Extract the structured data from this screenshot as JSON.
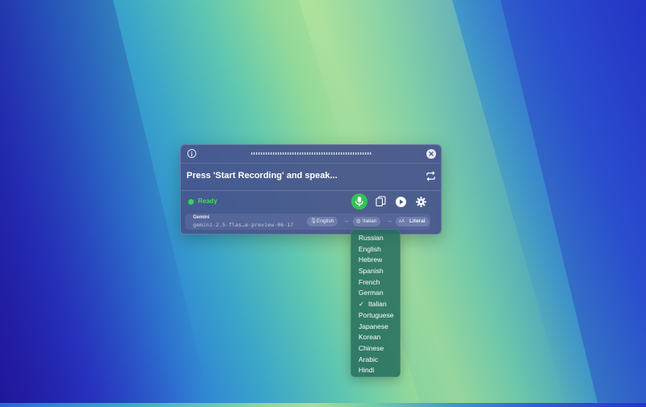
{
  "panel": {
    "prompt": "Press 'Start Recording' and speak...",
    "status": "Ready",
    "colors": {
      "status": "#39d353",
      "mic": "#35c15a"
    }
  },
  "model": {
    "provider": "Gemini",
    "id": "gemini-2.5-flas…e-preview-06-17"
  },
  "pipeline": {
    "source_language": "English",
    "target_language": "Italian",
    "mode": "Literal"
  },
  "language_menu": {
    "selected": "Italian",
    "check_mark": "✓",
    "items": [
      "Russian",
      "English",
      "Hebrew",
      "Spanish",
      "French",
      "German",
      "Italian",
      "Portuguese",
      "Japanese",
      "Korean",
      "Chinese",
      "Arabic",
      "Hindi"
    ]
  }
}
